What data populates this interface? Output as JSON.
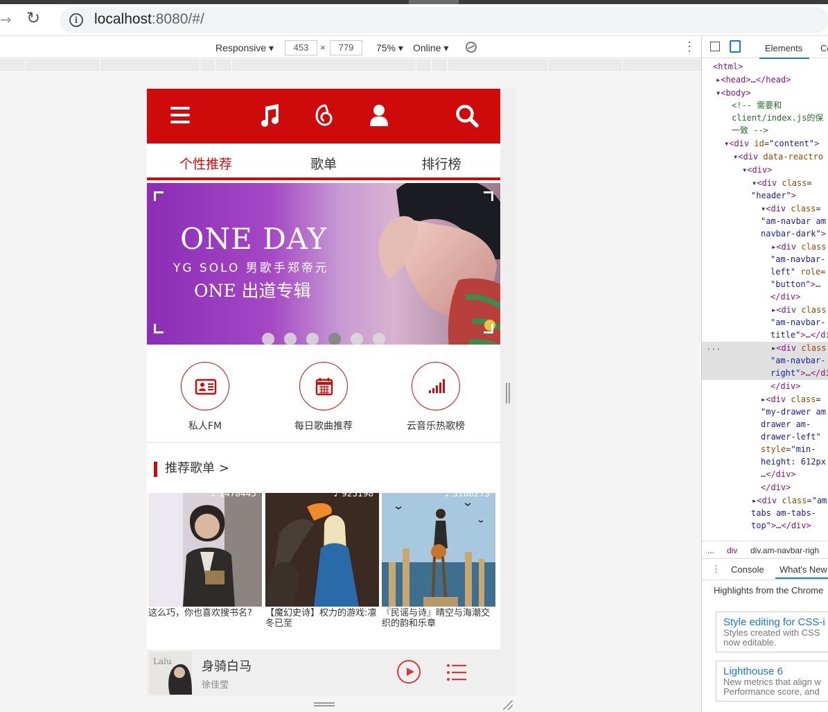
{
  "browser": {
    "url_host": "localhost",
    "url_rest": ":8080/#/"
  },
  "device_toolbar": {
    "device": "Responsive",
    "width": "453",
    "height": "779",
    "times": "×",
    "zoom": "75%",
    "network": "Online"
  },
  "app": {
    "tabs": [
      {
        "label": "个性推荐",
        "active": true
      },
      {
        "label": "歌单",
        "active": false
      },
      {
        "label": "排行榜",
        "active": false
      }
    ],
    "banner": {
      "title": "ONE DAY",
      "subtitle": "YG SOLO 男歌手郑帝元",
      "album": "ONE 出道专辑",
      "dot_count": 6,
      "active_dot": 3
    },
    "quick_entries": [
      {
        "label": "私人FM",
        "icon": "id-card-icon"
      },
      {
        "label": "每日歌曲推荐",
        "icon": "calendar-icon"
      },
      {
        "label": "云音乐热歌榜",
        "icon": "signal-bars-icon"
      }
    ],
    "section_title": "推荐歌单 >",
    "playlists": [
      {
        "title": "这么巧，你也喜欢搜书名?",
        "playcount": "1478445"
      },
      {
        "title": "【魔幻史诗】权力的游戏:凛冬已至",
        "playcount": "925198"
      },
      {
        "title": "『民谣与诗』晴空与海潮交织的韵和乐章",
        "playcount": "3186273"
      }
    ],
    "player": {
      "song": "身骑白马",
      "artist": "徐佳莹"
    },
    "accent": "#cf0a0a"
  },
  "devtools": {
    "tab_elements": "Elements",
    "tab_console_short": "Co",
    "breadcrumb_more": "...",
    "breadcrumb_div": "div",
    "breadcrumb_sel": "div.am-navbar-righ",
    "drawer_console": "Console",
    "drawer_whatsnew": "What's New",
    "highlights": "Highlights from the Chrome",
    "cards": [
      {
        "title": "Style editing for CSS-i",
        "desc1": "Styles created with CSS",
        "desc2": "now editable."
      },
      {
        "title": "Lighthouse 6",
        "desc1": "New metrics that align w",
        "desc2": "Performance score, and"
      }
    ]
  }
}
